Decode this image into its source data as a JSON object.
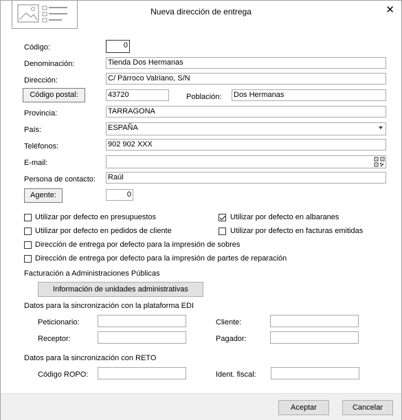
{
  "window": {
    "title": "Nueva dirección de entrega",
    "close_glyph": "✕",
    "logo_icon": "address-card-icon"
  },
  "form": {
    "codigo_label": "Código:",
    "codigo_value": "0",
    "denominacion_label": "Denominación:",
    "denominacion_value": "Tienda Dos Hermanas",
    "direccion_label": "Dirección:",
    "direccion_value": "C/ Párroco Valriano, S/N",
    "codigo_postal_button": "Código postal:",
    "codigo_postal_value": "43720",
    "poblacion_label": "Población:",
    "poblacion_value": "Dos Hermanas",
    "provincia_label": "Provincia:",
    "provincia_value": "TARRAGONA",
    "pais_label": "País:",
    "pais_value": "ESPAÑA",
    "telefonos_label": "Teléfonos:",
    "telefonos_value": "902 902 XXX",
    "email_label": "E-mail:",
    "email_value": "",
    "contacto_label": "Persona de contacto:",
    "contacto_value": "Raúl",
    "agente_button": "Agente:",
    "agente_value": "0"
  },
  "checkboxes": [
    {
      "label": "Utilizar por defecto en presupuestos",
      "checked": false
    },
    {
      "label": "Utilizar por defecto en albaranes",
      "checked": true
    },
    {
      "label": "Utilizar por defecto en pedidos de cliente",
      "checked": false
    },
    {
      "label": "Utilizar por defecto en facturas emitidas",
      "checked": false
    },
    {
      "label": "Dirección de entrega por defecto para la impresión de sobres",
      "checked": false
    },
    {
      "label": "Dirección de entrega por defecto para la impresión de partes de reparación",
      "checked": false
    }
  ],
  "facturacion": {
    "heading": "Facturación a Administraciones Públicas",
    "button": "Información de unidades administrativas"
  },
  "edi": {
    "heading": "Datos para la sincronización con la plataforma EDI",
    "peticionario_label": "Peticionario:",
    "cliente_label": "Cliente:",
    "receptor_label": "Receptor:",
    "pagador_label": "Pagador:"
  },
  "reto": {
    "heading": "Datos para la sincronización con RETO",
    "ropo_label": "Código ROPO:",
    "ident_label": "Ident. fiscal:"
  },
  "footer": {
    "accept": "Aceptar",
    "cancel": "Cancelar"
  }
}
